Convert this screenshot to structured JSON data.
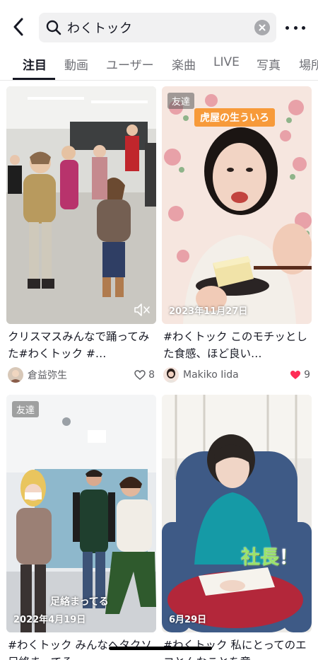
{
  "search": {
    "query": "わくトック"
  },
  "tabs": [
    {
      "label": "注目"
    },
    {
      "label": "動画"
    },
    {
      "label": "ユーザー"
    },
    {
      "label": "楽曲"
    },
    {
      "label": "LIVE"
    },
    {
      "label": "写真"
    },
    {
      "label": "場所"
    }
  ],
  "videos": [
    {
      "caption": "クリスマスみんなで踊ってみた#わくトック #…",
      "author": "倉益弥生",
      "likes": "8",
      "liked": false
    },
    {
      "badge": "友達",
      "tag": "虎屋の生ういろ",
      "date": "2023年11月27日",
      "caption": "#わくトック このモチッとした食感、ほど良い…",
      "author": "Makiko Iida",
      "likes": "9",
      "liked": true
    },
    {
      "badge": "友達",
      "overlay": "足絡まってる",
      "date": "2022年4月19日",
      "caption": "#わくトック みんなヘタクソ足絡まってる"
    },
    {
      "overlay": "社長",
      "overlay_suffix": "！",
      "date": "6月29日",
      "caption": "#わくトック 私にとってのエコとんなことを意"
    }
  ],
  "colors": {
    "accent": "#fe2c55",
    "tab_active": "#161823",
    "tab_inactive": "#6f7076",
    "orange_tag": "#f79a3a"
  }
}
